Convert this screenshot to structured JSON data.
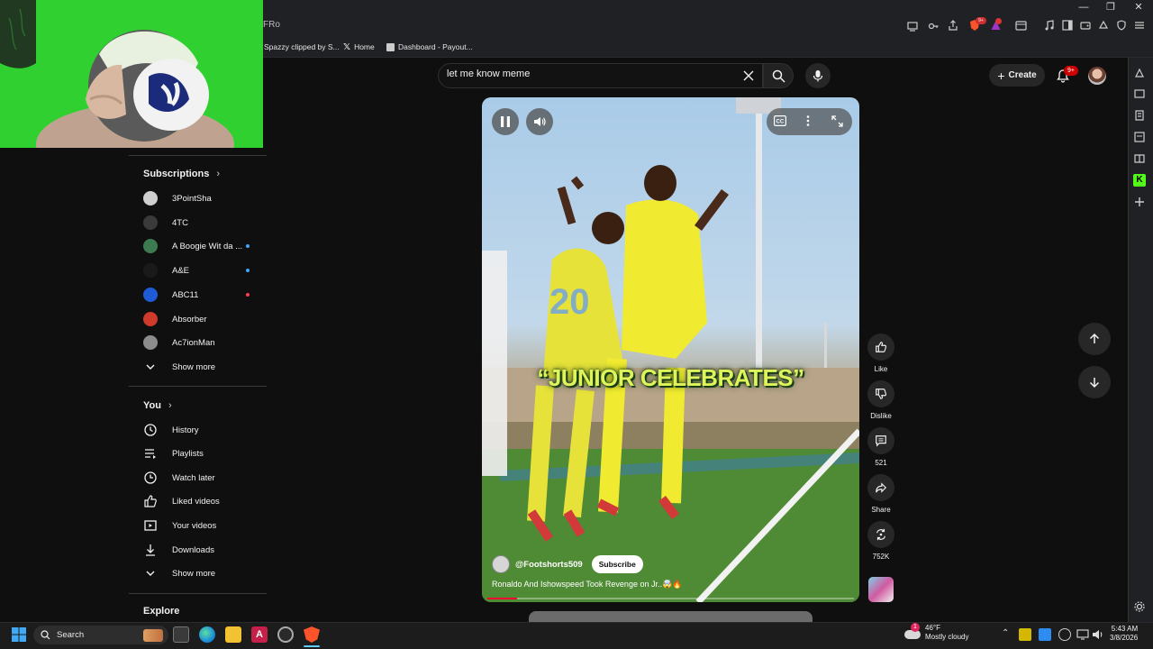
{
  "browser": {
    "tab_title": "FRo",
    "bookmarks": [
      "Spazzy clipped by S...",
      "Home",
      "Dashboard - Payout..."
    ],
    "notif_ext_badge": "9+"
  },
  "masthead": {
    "search_value": "let me know meme",
    "create_label": "Create",
    "notifications_badge": "9+"
  },
  "sidebar": {
    "subscriptions_title": "Subscriptions",
    "subscriptions": [
      {
        "name": "3PointSha",
        "color": "#cfcfcf",
        "dot": ""
      },
      {
        "name": "4TC",
        "color": "#3a3a3a",
        "dot": ""
      },
      {
        "name": "A Boogie Wit da ...",
        "color": "#3c7a4f",
        "dot": "#3ea6ff"
      },
      {
        "name": "A&E",
        "color": "#1a1a1a",
        "dot": "#3ea6ff"
      },
      {
        "name": "ABC11",
        "color": "#1f5bd6",
        "dot": "#ff3a55"
      },
      {
        "name": "Absorber",
        "color": "#d03a2a",
        "dot": ""
      },
      {
        "name": "Ac7ionMan",
        "color": "#8c8c8c",
        "dot": ""
      }
    ],
    "show_more": "Show more",
    "you_title": "You",
    "you_items": [
      {
        "label": "History",
        "icon": "history-icon"
      },
      {
        "label": "Playlists",
        "icon": "playlists-icon"
      },
      {
        "label": "Watch later",
        "icon": "watch-later-icon"
      },
      {
        "label": "Liked videos",
        "icon": "thumbs-up-icon"
      },
      {
        "label": "Your videos",
        "icon": "your-videos-icon"
      },
      {
        "label": "Downloads",
        "icon": "download-icon"
      }
    ],
    "show_more_2": "Show more",
    "explore_title": "Explore"
  },
  "short": {
    "overlay_text": "“JUNIOR CELEBRATES”",
    "channel": "@Footshorts509",
    "subscribe_label": "Subscribe",
    "title": "Ronaldo And Ishowspeed Took Revenge on Jr..🤯🔥",
    "progress": 0.08
  },
  "actions": {
    "like": "Like",
    "dislike": "Dislike",
    "comments": "521",
    "share": "Share",
    "remix": "752K"
  },
  "taskbar": {
    "search_label": "Search",
    "weather_temp": "46°F",
    "weather_desc": "Mostly cloudy",
    "weather_badge": "1",
    "time": "5:43 AM",
    "date": "3/8/2026"
  },
  "colors": {
    "accent_red": "#ff0033",
    "background": "#0f0f0f",
    "webcam_green": "#2fd02f",
    "overlay_text": "#dff45a"
  }
}
